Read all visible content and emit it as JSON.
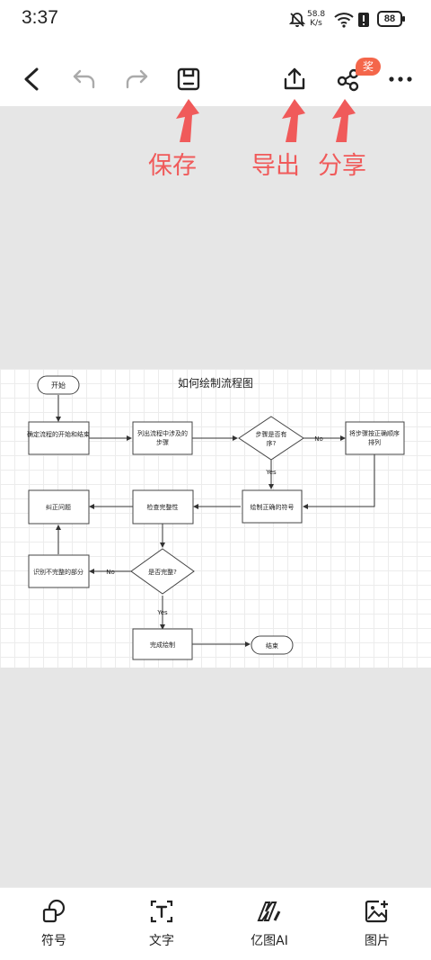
{
  "status": {
    "time": "3:37",
    "net_speed_value": "58.8",
    "net_speed_unit": "K/s",
    "battery": "88"
  },
  "toolbar": {
    "reward_badge": "奖",
    "buttons": [
      "back-icon",
      "undo-icon",
      "redo-icon",
      "save-icon",
      "export-icon",
      "share-icon",
      "more-icon"
    ]
  },
  "annotations": {
    "save": "保存",
    "export": "导出",
    "share": "分享"
  },
  "diagram": {
    "title": "如何绘制流程图",
    "start": "开始",
    "step1": "确定流程的开始和结束",
    "step2_l1": "列出流程中涉及的",
    "step2_l2": "步骤",
    "decision1_l1": "步骤是否有",
    "decision1_l2": "序?",
    "no1": "No",
    "yes1": "Yes",
    "step3_l1": "将步骤按正确顺序",
    "step3_l2": "排列",
    "step4": "绘制正确的符号",
    "step5": "检查完整性",
    "step6": "纠正问题",
    "step7": "识别不完整的部分",
    "decision2": "是否完整?",
    "no2": "No",
    "yes2": "Yes",
    "step8": "完成绘制",
    "end": "结束"
  },
  "bottom_bar": {
    "symbol": "符号",
    "text": "文字",
    "ai": "亿图AI",
    "image": "图片"
  }
}
